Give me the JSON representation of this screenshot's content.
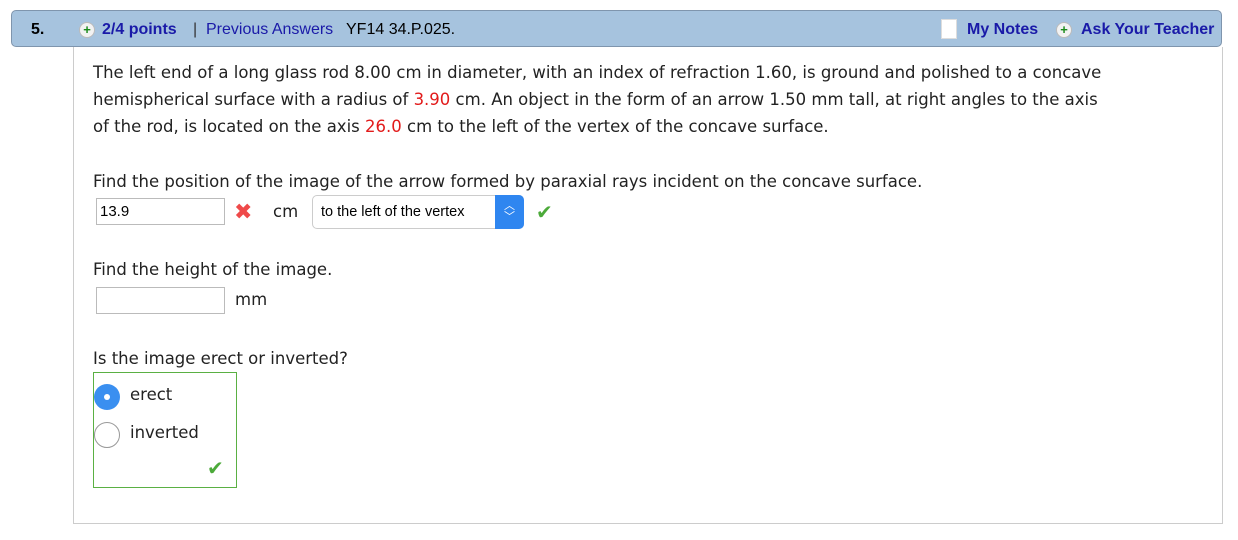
{
  "header": {
    "number": "5.",
    "points": "2/4 points",
    "separator": "|",
    "previous_answers": "Previous Answers",
    "code": "YF14 34.P.025.",
    "my_notes": "My Notes",
    "ask_teacher": "Ask Your Teacher"
  },
  "problem": {
    "p1": "The left end of a long glass rod 8.00 cm in diameter, with an index of refraction 1.60, is ground and polished to a concave",
    "p2a": "hemispherical surface with a radius of ",
    "p2b": "3.90",
    "p2c": " cm. An object in the form of an arrow 1.50 mm tall, at right angles to the axis",
    "p3a": "of the rod, is located on the axis ",
    "p3b": "26.0",
    "p3c": " cm to the left of the vertex of the concave surface."
  },
  "q1": {
    "prompt": "Find the position of the image of the arrow formed by paraxial rays incident on the concave surface.",
    "value": "13.9",
    "status": "incorrect",
    "unit": "cm",
    "select": "to the left of the vertex",
    "select_status": "correct"
  },
  "q2": {
    "prompt": "Find the height of the image.",
    "value": "",
    "unit": "mm"
  },
  "q3": {
    "prompt": "Is the image erect or inverted?",
    "options": [
      "erect",
      "inverted"
    ],
    "selected": "erect",
    "status": "correct"
  }
}
